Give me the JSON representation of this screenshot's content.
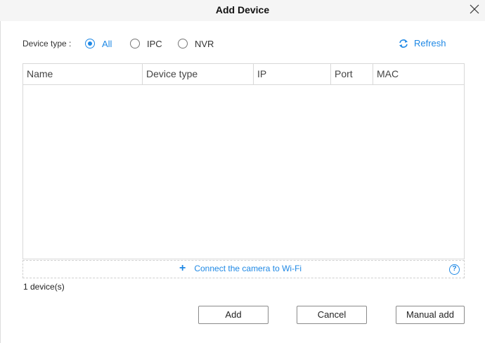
{
  "window": {
    "title": "Add Device"
  },
  "filter": {
    "label": "Device type :",
    "options": [
      {
        "label": "All",
        "selected": true
      },
      {
        "label": "IPC",
        "selected": false
      },
      {
        "label": "NVR",
        "selected": false
      }
    ],
    "refresh_label": "Refresh"
  },
  "table": {
    "columns": [
      "Name",
      "Device type",
      "IP",
      "Port",
      "MAC"
    ],
    "rows": []
  },
  "connect": {
    "label": "Connect the camera to Wi-Fi"
  },
  "status": {
    "count_text": "1 device(s)"
  },
  "buttons": {
    "add": "Add",
    "cancel": "Cancel",
    "manual_add": "Manual add"
  },
  "colors": {
    "accent": "#1e88e5",
    "border": "#d8d8d8",
    "titlebar": "#f5f5f5"
  }
}
